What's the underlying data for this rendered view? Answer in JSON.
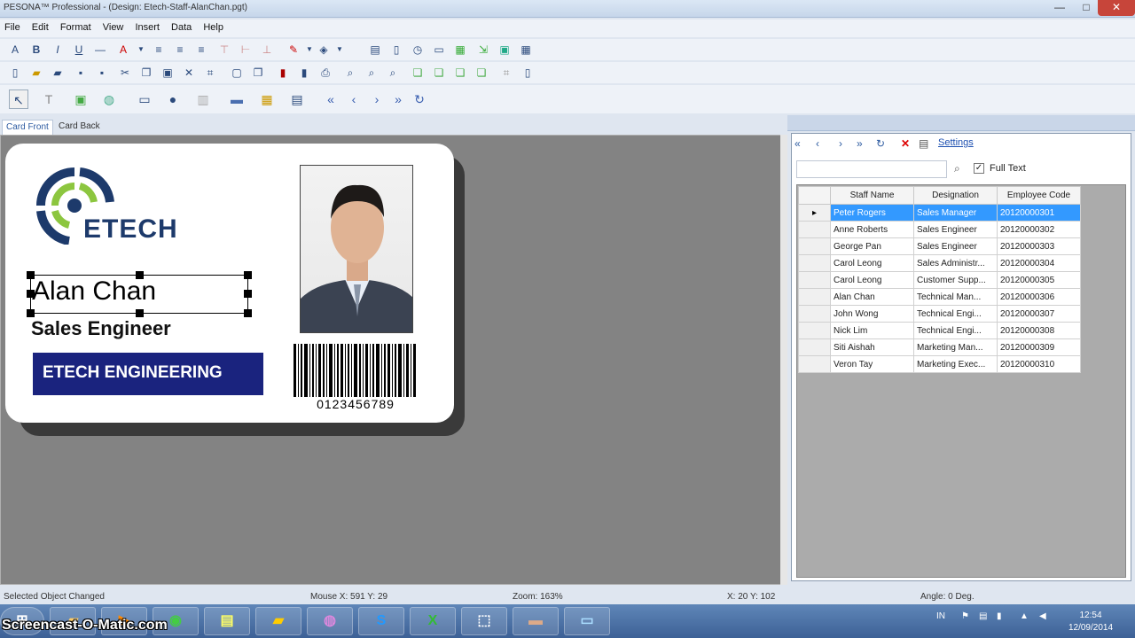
{
  "window": {
    "title": "PESONA™ Professional - (Design: Etech-Staff-AlanChan.pgt)",
    "minimize": "—",
    "maximize": "□",
    "close": "✕"
  },
  "menu": [
    "File",
    "Edit",
    "Format",
    "View",
    "Insert",
    "Data",
    "Help"
  ],
  "tabs": {
    "front": "Card Front",
    "back": "Card Back"
  },
  "card": {
    "logo_text": "ETECH",
    "name": "Alan Chan",
    "designation": "Sales Engineer",
    "company": "ETECH ENGINEERING",
    "barcode_number": "0123456789",
    "company_color": "#1a237e"
  },
  "panel": {
    "settings_label": "Settings",
    "search_value": "",
    "full_text_label": "Full Text",
    "full_text_checked": true,
    "columns": [
      "Staff Name",
      "Designation",
      "Employee Code"
    ],
    "rows": [
      [
        "Peter Rogers",
        "Sales Manager",
        "20120000301"
      ],
      [
        "Anne Roberts",
        "Sales Engineer",
        "20120000302"
      ],
      [
        "George Pan",
        "Sales Engineer",
        "20120000303"
      ],
      [
        "Carol Leong",
        "Sales Administr...",
        "20120000304"
      ],
      [
        "Carol Leong",
        "Customer Supp...",
        "20120000305"
      ],
      [
        "Alan Chan",
        "Technical Man...",
        "20120000306"
      ],
      [
        "John Wong",
        "Technical Engi...",
        "20120000307"
      ],
      [
        "Nick Lim",
        "Technical Engi...",
        "20120000308"
      ],
      [
        "Siti Aishah",
        "Marketing Man...",
        "20120000309"
      ],
      [
        "Veron Tay",
        "Marketing Exec...",
        "20120000310"
      ]
    ],
    "selected_row": 0
  },
  "status": {
    "message": "Selected Object Changed",
    "mouse": "Mouse X: 591  Y: 29",
    "zoom": "Zoom: 163%",
    "position": "X: 20  Y: 102",
    "angle": "Angle: 0 Deg."
  },
  "taskbar": {
    "watermark": "Screencast-O-Matic.com",
    "lang": "IN",
    "time": "12:54",
    "date": "12/09/2014"
  }
}
